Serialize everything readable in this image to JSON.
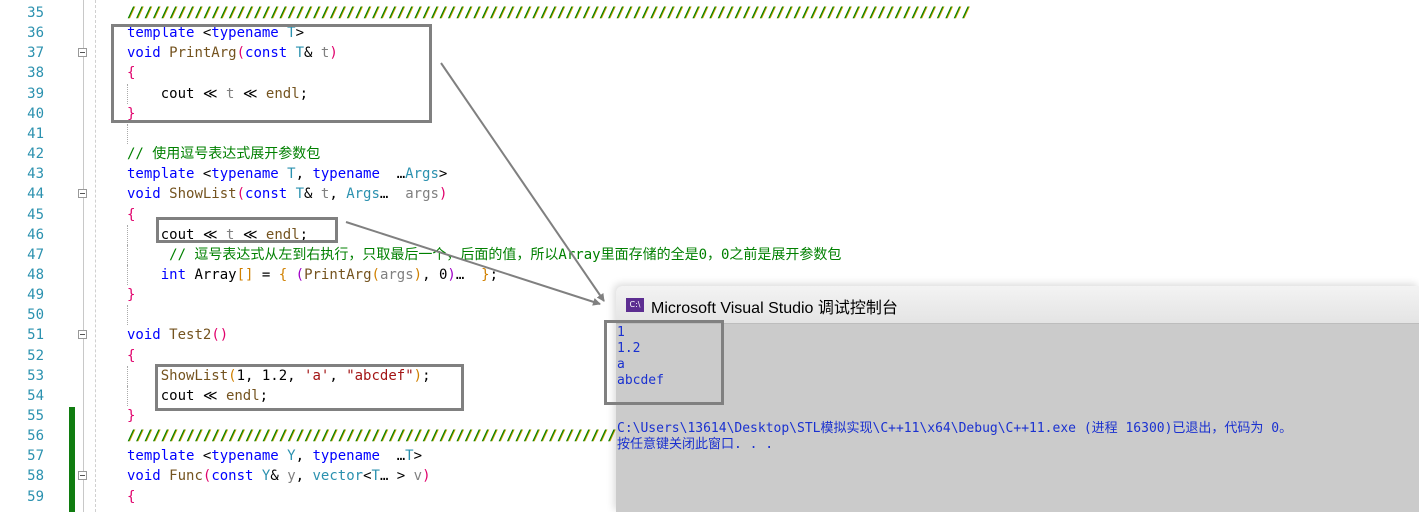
{
  "editor": {
    "lines": [
      {
        "n": "35",
        "segments": [
          {
            "c": "slashes",
            "t": "////////////////////////////////////////////////////////////////////////////////////////////////////"
          }
        ]
      },
      {
        "n": "36",
        "segments": [
          {
            "c": "kw",
            "t": "template "
          },
          {
            "c": "txt",
            "t": "<"
          },
          {
            "c": "kw",
            "t": "typename "
          },
          {
            "c": "ty",
            "t": "T"
          },
          {
            "c": "txt",
            "t": ">"
          }
        ]
      },
      {
        "n": "37",
        "fold": true,
        "segments": [
          {
            "c": "kw",
            "t": "void "
          },
          {
            "c": "fn",
            "t": "PrintArg"
          },
          {
            "c": "br1",
            "t": "("
          },
          {
            "c": "kw",
            "t": "const "
          },
          {
            "c": "ty",
            "t": "T"
          },
          {
            "c": "txt",
            "t": "& "
          },
          {
            "c": "var",
            "t": "t"
          },
          {
            "c": "br1",
            "t": ")"
          }
        ]
      },
      {
        "n": "38",
        "segments": [
          {
            "c": "br1",
            "t": "{"
          }
        ]
      },
      {
        "n": "39",
        "indent": true,
        "segments": [
          {
            "c": "txt",
            "t": "    cout "
          },
          {
            "c": "txt",
            "t": "≪ "
          },
          {
            "c": "var",
            "t": "t"
          },
          {
            "c": "txt",
            "t": " ≪ "
          },
          {
            "c": "fn",
            "t": "endl"
          },
          {
            "c": "txt",
            "t": ";"
          }
        ]
      },
      {
        "n": "40",
        "segments": [
          {
            "c": "br1",
            "t": "}"
          }
        ]
      },
      {
        "n": "41",
        "indent": true,
        "segments": []
      },
      {
        "n": "42",
        "segments": [
          {
            "c": "cm",
            "t": "// 使用逗号表达式展开参数包"
          }
        ]
      },
      {
        "n": "43",
        "segments": [
          {
            "c": "kw",
            "t": "template "
          },
          {
            "c": "txt",
            "t": "<"
          },
          {
            "c": "kw",
            "t": "typename "
          },
          {
            "c": "ty",
            "t": "T"
          },
          {
            "c": "txt",
            "t": ", "
          },
          {
            "c": "kw",
            "t": "typename "
          },
          {
            "c": "txt",
            "t": " …"
          },
          {
            "c": "ty",
            "t": "Args"
          },
          {
            "c": "txt",
            "t": ">"
          }
        ]
      },
      {
        "n": "44",
        "fold": true,
        "segments": [
          {
            "c": "kw",
            "t": "void "
          },
          {
            "c": "fn",
            "t": "ShowList"
          },
          {
            "c": "br1",
            "t": "("
          },
          {
            "c": "kw",
            "t": "const "
          },
          {
            "c": "ty",
            "t": "T"
          },
          {
            "c": "txt",
            "t": "& "
          },
          {
            "c": "var",
            "t": "t"
          },
          {
            "c": "txt",
            "t": ", "
          },
          {
            "c": "ty",
            "t": "Args"
          },
          {
            "c": "txt",
            "t": "…  "
          },
          {
            "c": "var",
            "t": "args"
          },
          {
            "c": "br1",
            "t": ")"
          }
        ]
      },
      {
        "n": "45",
        "segments": [
          {
            "c": "br1",
            "t": "{"
          }
        ]
      },
      {
        "n": "46",
        "indent": true,
        "segments": [
          {
            "c": "txt",
            "t": "    cout "
          },
          {
            "c": "txt",
            "t": "≪ "
          },
          {
            "c": "var",
            "t": "t"
          },
          {
            "c": "txt",
            "t": " ≪ "
          },
          {
            "c": "fn",
            "t": "endl"
          },
          {
            "c": "txt",
            "t": ";"
          }
        ]
      },
      {
        "n": "47",
        "indent": true,
        "segments": [
          {
            "c": "cm",
            "t": "     // 逗号表达式从左到右执行，只取最后一个，后面的值，所以Array里面存储的全是0，0之前是展开参数包"
          }
        ]
      },
      {
        "n": "48",
        "indent": true,
        "segments": [
          {
            "c": "kw",
            "t": "    int "
          },
          {
            "c": "txt",
            "t": "Array"
          },
          {
            "c": "br3",
            "t": "[]"
          },
          {
            "c": "txt",
            "t": " = "
          },
          {
            "c": "br3",
            "t": "{"
          },
          {
            "c": "txt",
            "t": " "
          },
          {
            "c": "br2",
            "t": "("
          },
          {
            "c": "fn",
            "t": "PrintArg"
          },
          {
            "c": "br3",
            "t": "("
          },
          {
            "c": "var",
            "t": "args"
          },
          {
            "c": "br3",
            "t": ")"
          },
          {
            "c": "txt",
            "t": ", 0"
          },
          {
            "c": "br2",
            "t": ")"
          },
          {
            "c": "txt",
            "t": "…  "
          },
          {
            "c": "br3",
            "t": "}"
          },
          {
            "c": "txt",
            "t": ";"
          }
        ]
      },
      {
        "n": "49",
        "segments": [
          {
            "c": "br1",
            "t": "}"
          }
        ]
      },
      {
        "n": "50",
        "indent": true,
        "segments": []
      },
      {
        "n": "51",
        "fold": true,
        "segments": [
          {
            "c": "kw",
            "t": "void "
          },
          {
            "c": "fn",
            "t": "Test2"
          },
          {
            "c": "br1",
            "t": "()"
          }
        ]
      },
      {
        "n": "52",
        "segments": [
          {
            "c": "br1",
            "t": "{"
          }
        ]
      },
      {
        "n": "53",
        "indent": true,
        "segments": [
          {
            "c": "fn",
            "t": "    ShowList"
          },
          {
            "c": "br3",
            "t": "("
          },
          {
            "c": "txt",
            "t": "1, 1.2, "
          },
          {
            "c": "str",
            "t": "'a'"
          },
          {
            "c": "txt",
            "t": ", "
          },
          {
            "c": "str",
            "t": "\"abcdef\""
          },
          {
            "c": "br3",
            "t": ")"
          },
          {
            "c": "txt",
            "t": ";"
          }
        ]
      },
      {
        "n": "54",
        "indent": true,
        "segments": [
          {
            "c": "txt",
            "t": "    cout "
          },
          {
            "c": "txt",
            "t": "≪ "
          },
          {
            "c": "fn",
            "t": "endl"
          },
          {
            "c": "txt",
            "t": ";"
          }
        ]
      },
      {
        "n": "55",
        "segments": [
          {
            "c": "br1",
            "t": "}"
          }
        ]
      },
      {
        "n": "56",
        "segments": [
          {
            "c": "slashes",
            "t": "/////////////////////////////////////////////////////////////////////"
          }
        ]
      },
      {
        "n": "57",
        "segments": [
          {
            "c": "kw",
            "t": "template "
          },
          {
            "c": "txt",
            "t": "<"
          },
          {
            "c": "kw",
            "t": "typename "
          },
          {
            "c": "ty",
            "t": "Y"
          },
          {
            "c": "txt",
            "t": ", "
          },
          {
            "c": "kw",
            "t": "typename "
          },
          {
            "c": "txt",
            "t": " …"
          },
          {
            "c": "ty",
            "t": "T"
          },
          {
            "c": "txt",
            "t": ">"
          }
        ]
      },
      {
        "n": "58",
        "fold": true,
        "segments": [
          {
            "c": "kw",
            "t": "void "
          },
          {
            "c": "fn",
            "t": "Func"
          },
          {
            "c": "br1",
            "t": "("
          },
          {
            "c": "kw",
            "t": "const "
          },
          {
            "c": "ty",
            "t": "Y"
          },
          {
            "c": "txt",
            "t": "& "
          },
          {
            "c": "var",
            "t": "y"
          },
          {
            "c": "txt",
            "t": ", "
          },
          {
            "c": "ty",
            "t": "vector"
          },
          {
            "c": "txt",
            "t": "<"
          },
          {
            "c": "ty",
            "t": "T"
          },
          {
            "c": "txt",
            "t": "… > "
          },
          {
            "c": "var",
            "t": "v"
          },
          {
            "c": "br1",
            "t": ")"
          }
        ]
      },
      {
        "n": "59",
        "segments": [
          {
            "c": "br1",
            "t": "{"
          }
        ]
      }
    ]
  },
  "console": {
    "title": "Microsoft Visual Studio 调试控制台",
    "icon_label": "C:\\",
    "output": [
      "1",
      "1.2",
      "a",
      "abcdef",
      "",
      "",
      "C:\\Users\\13614\\Desktop\\STL模拟实现\\C++11\\x64\\Debug\\C++11.exe (进程 16300)已退出，代码为 0。",
      "按任意键关闭此窗口. . ."
    ]
  }
}
